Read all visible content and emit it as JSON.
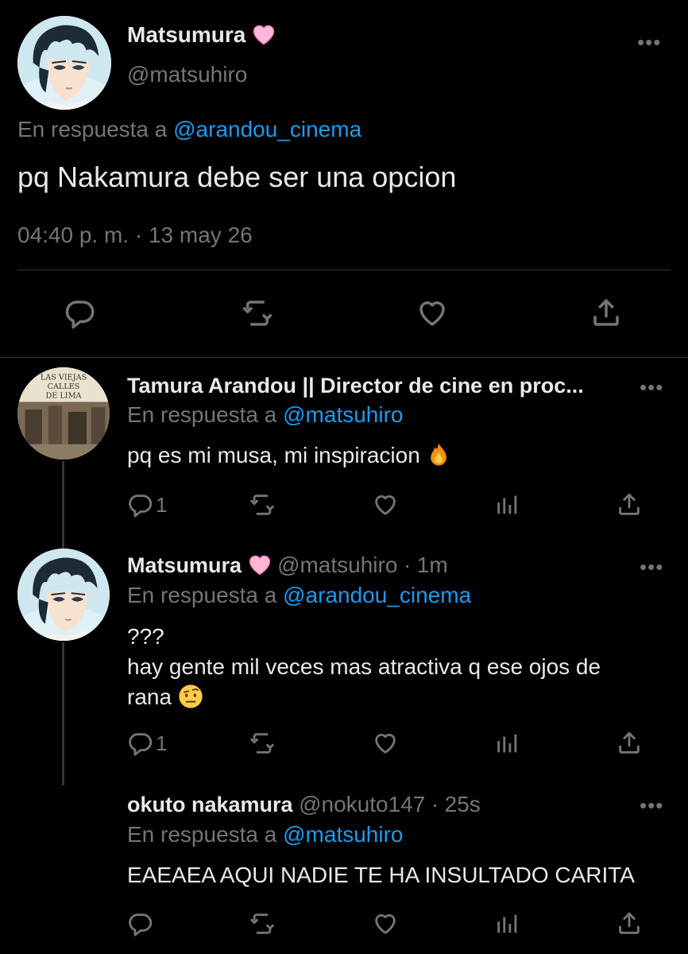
{
  "main_tweet": {
    "author_name": "Matsumura",
    "author_handle": "@matsuhiro",
    "reply_prefix": "En respuesta a",
    "reply_to": "@arandou_cinema",
    "text": "pq Nakamura debe ser una opcion",
    "timestamp": "04:40 p. m. · 13 may 26",
    "avatar": "anime-boy-avatar"
  },
  "replies": [
    {
      "author_name": "Tamura Arandou || Director de cine en proc...",
      "author_handle": "",
      "time": "",
      "reply_prefix": "En respuesta a",
      "reply_to": "@matsuhiro",
      "text": "pq es mi musa, mi inspiracion",
      "emoji": "fire-emoji",
      "reply_count": "1",
      "avatar": "book-cover-avatar",
      "avatar_text": "LAS VIEJAS CALLES DE LIMA"
    },
    {
      "author_name": "Matsumura",
      "author_handle": "@matsuhiro",
      "time": "1m",
      "reply_prefix": "En respuesta a",
      "reply_to": "@arandou_cinema",
      "text_line1": "???",
      "text_line2": "hay gente mil veces mas atractiva q ese ojos de",
      "text_line3": "rana",
      "emoji": "raised-eyebrow-emoji",
      "reply_count": "1",
      "avatar": "anime-boy-avatar"
    },
    {
      "author_name": "okuto nakamura",
      "author_handle": "@nokuto147",
      "time": "25s",
      "reply_prefix": "En respuesta a",
      "reply_to": "@matsuhiro",
      "text": "EAEAEA AQUI NADIE TE HA INSULTADO CARITA",
      "reply_count": ""
    }
  ],
  "more_label": "•••",
  "dot_separator": "·",
  "colors": {
    "background": "#000000",
    "text": "#e7e9ea",
    "secondary": "#71767b",
    "accent": "#1d9bf0",
    "divider": "#2f3336"
  }
}
